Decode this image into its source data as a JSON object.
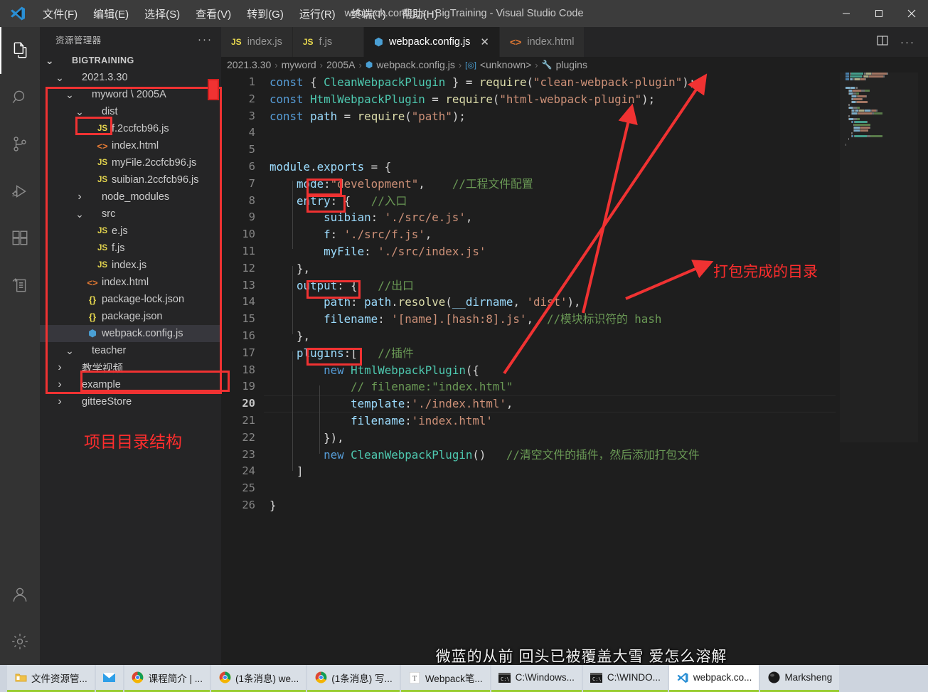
{
  "window": {
    "title": "webpack.config.js - BigTraining - Visual Studio Code",
    "minimize": "–",
    "maximize": "☐",
    "close": "✕"
  },
  "menu": [
    {
      "label": "文件(F)",
      "name": "menu-file"
    },
    {
      "label": "编辑(E)",
      "name": "menu-edit"
    },
    {
      "label": "选择(S)",
      "name": "menu-selection"
    },
    {
      "label": "查看(V)",
      "name": "menu-view"
    },
    {
      "label": "转到(G)",
      "name": "menu-go"
    },
    {
      "label": "运行(R)",
      "name": "menu-run"
    },
    {
      "label": "终端(T)",
      "name": "menu-terminal"
    },
    {
      "label": "帮助(H)",
      "name": "menu-help"
    }
  ],
  "activity_bar": {
    "items": [
      {
        "icon": "explorer-icon",
        "active": true
      },
      {
        "icon": "search-icon",
        "active": false
      },
      {
        "icon": "source-control-icon",
        "active": false
      },
      {
        "icon": "run-debug-icon",
        "active": false
      },
      {
        "icon": "extensions-icon",
        "active": false
      },
      {
        "icon": "remote-explorer-icon",
        "active": false
      }
    ],
    "bottom": [
      {
        "icon": "account-icon"
      },
      {
        "icon": "gear-icon"
      }
    ]
  },
  "sidebar": {
    "header": "资源管理器",
    "more": "···",
    "tree": [
      {
        "depth": 0,
        "chev": "v",
        "label": "BIGTRAINING",
        "icon": "",
        "root": true
      },
      {
        "depth": 1,
        "chev": "v",
        "label": "2021.3.30",
        "icon": ""
      },
      {
        "depth": 2,
        "chev": "v",
        "label": "myword \\ 2005A",
        "icon": ""
      },
      {
        "depth": 3,
        "chev": "v",
        "label": "dist",
        "icon": ""
      },
      {
        "depth": 4,
        "chev": "",
        "label": "f.2ccfcb96.js",
        "icon": "js"
      },
      {
        "depth": 4,
        "chev": "",
        "label": "index.html",
        "icon": "html"
      },
      {
        "depth": 4,
        "chev": "",
        "label": "myFile.2ccfcb96.js",
        "icon": "js"
      },
      {
        "depth": 4,
        "chev": "",
        "label": "suibian.2ccfcb96.js",
        "icon": "js"
      },
      {
        "depth": 3,
        "chev": ">",
        "label": "node_modules",
        "icon": ""
      },
      {
        "depth": 3,
        "chev": "v",
        "label": "src",
        "icon": ""
      },
      {
        "depth": 4,
        "chev": "",
        "label": "e.js",
        "icon": "js"
      },
      {
        "depth": 4,
        "chev": "",
        "label": "f.js",
        "icon": "js"
      },
      {
        "depth": 4,
        "chev": "",
        "label": "index.js",
        "icon": "js"
      },
      {
        "depth": 3,
        "chev": "",
        "label": "index.html",
        "icon": "html"
      },
      {
        "depth": 3,
        "chev": "",
        "label": "package-lock.json",
        "icon": "json"
      },
      {
        "depth": 3,
        "chev": "",
        "label": "package.json",
        "icon": "json"
      },
      {
        "depth": 3,
        "chev": "",
        "label": "webpack.config.js",
        "icon": "wp",
        "selected": true
      },
      {
        "depth": 2,
        "chev": "v",
        "label": "teacher",
        "icon": ""
      },
      {
        "depth": 1,
        "chev": ">",
        "label": "教学视频",
        "icon": ""
      },
      {
        "depth": 1,
        "chev": ">",
        "label": "example",
        "icon": ""
      },
      {
        "depth": 1,
        "chev": ">",
        "label": "gitteeStore",
        "icon": ""
      }
    ]
  },
  "tabs": [
    {
      "label": "index.js",
      "icon": "js-icon",
      "active": false,
      "dirty": false
    },
    {
      "label": "f.js",
      "icon": "js-icon",
      "active": false,
      "dirty": false
    },
    {
      "label": "webpack.config.js",
      "icon": "webpack-icon",
      "active": true,
      "close": "✕"
    },
    {
      "label": "index.html",
      "icon": "html-icon",
      "active": false,
      "dirty": false
    }
  ],
  "tab_actions": {
    "split_editor": "split-editor-icon",
    "more": "···"
  },
  "breadcrumb": [
    {
      "label": "2021.3.30",
      "icon": ""
    },
    {
      "label": "myword",
      "icon": ""
    },
    {
      "label": "2005A",
      "icon": ""
    },
    {
      "label": "webpack.config.js",
      "icon": "webpack-icon"
    },
    {
      "label": "<unknown>",
      "icon": "symbol-icon"
    },
    {
      "label": "plugins",
      "icon": "wrench-icon"
    }
  ],
  "editor": {
    "line_count": 26,
    "current_line": 20,
    "lines": [
      {
        "n": 1,
        "tokens": [
          {
            "t": "k",
            "v": "const"
          },
          {
            "t": "op",
            "v": " { "
          },
          {
            "t": "t",
            "v": "CleanWebpackPlugin"
          },
          {
            "t": "op",
            "v": " } = "
          },
          {
            "t": "f",
            "v": "require"
          },
          {
            "t": "op",
            "v": "("
          },
          {
            "t": "s",
            "v": "\"clean-webpack-plugin\""
          },
          {
            "t": "op",
            "v": ");"
          }
        ]
      },
      {
        "n": 2,
        "tokens": [
          {
            "t": "k",
            "v": "const"
          },
          {
            "t": "op",
            "v": " "
          },
          {
            "t": "t",
            "v": "HtmlWebpackPlugin"
          },
          {
            "t": "op",
            "v": " = "
          },
          {
            "t": "f",
            "v": "require"
          },
          {
            "t": "op",
            "v": "("
          },
          {
            "t": "s",
            "v": "\"html-webpack-plugin\""
          },
          {
            "t": "op",
            "v": ");"
          }
        ]
      },
      {
        "n": 3,
        "tokens": [
          {
            "t": "k",
            "v": "const"
          },
          {
            "t": "op",
            "v": " "
          },
          {
            "t": "p",
            "v": "path"
          },
          {
            "t": "op",
            "v": " = "
          },
          {
            "t": "f",
            "v": "require"
          },
          {
            "t": "op",
            "v": "("
          },
          {
            "t": "s",
            "v": "\"path\""
          },
          {
            "t": "op",
            "v": ");"
          }
        ]
      },
      {
        "n": 4,
        "tokens": []
      },
      {
        "n": 5,
        "tokens": []
      },
      {
        "n": 6,
        "tokens": [
          {
            "t": "p",
            "v": "module"
          },
          {
            "t": "op",
            "v": "."
          },
          {
            "t": "p",
            "v": "exports"
          },
          {
            "t": "op",
            "v": " = {"
          }
        ]
      },
      {
        "n": 7,
        "tokens": [
          {
            "t": "op",
            "v": "    "
          },
          {
            "t": "p",
            "v": "mode"
          },
          {
            "t": "op",
            "v": ":"
          },
          {
            "t": "s",
            "v": "\"development\""
          },
          {
            "t": "op",
            "v": ",    "
          },
          {
            "t": "c",
            "v": "//工程文件配置"
          }
        ]
      },
      {
        "n": 8,
        "tokens": [
          {
            "t": "op",
            "v": "    "
          },
          {
            "t": "p",
            "v": "entry"
          },
          {
            "t": "op",
            "v": ": {   "
          },
          {
            "t": "c",
            "v": "//入口"
          }
        ]
      },
      {
        "n": 9,
        "tokens": [
          {
            "t": "op",
            "v": "        "
          },
          {
            "t": "p",
            "v": "suibian"
          },
          {
            "t": "op",
            "v": ": "
          },
          {
            "t": "s",
            "v": "'./src/e.js'"
          },
          {
            "t": "op",
            "v": ","
          }
        ]
      },
      {
        "n": 10,
        "tokens": [
          {
            "t": "op",
            "v": "        "
          },
          {
            "t": "p",
            "v": "f"
          },
          {
            "t": "op",
            "v": ": "
          },
          {
            "t": "s",
            "v": "'./src/f.js'"
          },
          {
            "t": "op",
            "v": ","
          }
        ]
      },
      {
        "n": 11,
        "tokens": [
          {
            "t": "op",
            "v": "        "
          },
          {
            "t": "p",
            "v": "myFile"
          },
          {
            "t": "op",
            "v": ": "
          },
          {
            "t": "s",
            "v": "'./src/index.js'"
          }
        ]
      },
      {
        "n": 12,
        "tokens": [
          {
            "t": "op",
            "v": "    },"
          }
        ]
      },
      {
        "n": 13,
        "tokens": [
          {
            "t": "op",
            "v": "    "
          },
          {
            "t": "p",
            "v": "output"
          },
          {
            "t": "op",
            "v": ": {   "
          },
          {
            "t": "c",
            "v": "//出口"
          }
        ]
      },
      {
        "n": 14,
        "tokens": [
          {
            "t": "op",
            "v": "        "
          },
          {
            "t": "p",
            "v": "path"
          },
          {
            "t": "op",
            "v": ": "
          },
          {
            "t": "p",
            "v": "path"
          },
          {
            "t": "op",
            "v": "."
          },
          {
            "t": "f",
            "v": "resolve"
          },
          {
            "t": "op",
            "v": "("
          },
          {
            "t": "p",
            "v": "__dirname"
          },
          {
            "t": "op",
            "v": ", "
          },
          {
            "t": "s",
            "v": "'dist'"
          },
          {
            "t": "op",
            "v": "),"
          }
        ]
      },
      {
        "n": 15,
        "tokens": [
          {
            "t": "op",
            "v": "        "
          },
          {
            "t": "p",
            "v": "filename"
          },
          {
            "t": "op",
            "v": ": "
          },
          {
            "t": "s",
            "v": "'[name].[hash:8].js'"
          },
          {
            "t": "op",
            "v": ",  "
          },
          {
            "t": "c",
            "v": "//模块标识符的 hash"
          }
        ]
      },
      {
        "n": 16,
        "tokens": [
          {
            "t": "op",
            "v": "    },"
          }
        ]
      },
      {
        "n": 17,
        "tokens": [
          {
            "t": "op",
            "v": "    "
          },
          {
            "t": "p",
            "v": "plugins"
          },
          {
            "t": "op",
            "v": ":[   "
          },
          {
            "t": "c",
            "v": "//插件"
          }
        ]
      },
      {
        "n": 18,
        "tokens": [
          {
            "t": "op",
            "v": "        "
          },
          {
            "t": "k",
            "v": "new"
          },
          {
            "t": "op",
            "v": " "
          },
          {
            "t": "t",
            "v": "HtmlWebpackPlugin"
          },
          {
            "t": "op",
            "v": "({"
          }
        ]
      },
      {
        "n": 19,
        "tokens": [
          {
            "t": "op",
            "v": "            "
          },
          {
            "t": "c",
            "v": "// filename:\"index.html\""
          }
        ]
      },
      {
        "n": 20,
        "tokens": [
          {
            "t": "op",
            "v": "            "
          },
          {
            "t": "p",
            "v": "template"
          },
          {
            "t": "op",
            "v": ":"
          },
          {
            "t": "s",
            "v": "'./index.html'"
          },
          {
            "t": "op",
            "v": ","
          }
        ]
      },
      {
        "n": 21,
        "tokens": [
          {
            "t": "op",
            "v": "            "
          },
          {
            "t": "p",
            "v": "filename"
          },
          {
            "t": "op",
            "v": ":"
          },
          {
            "t": "s",
            "v": "'index.html'"
          }
        ]
      },
      {
        "n": 22,
        "tokens": [
          {
            "t": "op",
            "v": "        }),"
          }
        ]
      },
      {
        "n": 23,
        "tokens": [
          {
            "t": "op",
            "v": "        "
          },
          {
            "t": "k",
            "v": "new"
          },
          {
            "t": "op",
            "v": " "
          },
          {
            "t": "t",
            "v": "CleanWebpackPlugin"
          },
          {
            "t": "op",
            "v": "()   "
          },
          {
            "t": "c",
            "v": "//清空文件的插件，然后添加打包文件"
          }
        ]
      },
      {
        "n": 24,
        "tokens": [
          {
            "t": "op",
            "v": "    ]"
          }
        ]
      },
      {
        "n": 25,
        "tokens": []
      },
      {
        "n": 26,
        "tokens": [
          {
            "t": "op",
            "v": "}"
          }
        ]
      }
    ]
  },
  "annotations": {
    "color": "#ff2d2d",
    "label_output_dir": "打包完成的目录",
    "label_project_tree": "项目目录结构",
    "boxes": [
      {
        "name": "dist-highlight"
      },
      {
        "name": "webpack-config-highlight"
      },
      {
        "name": "project-tree-highlight"
      },
      {
        "name": "mode-key-highlight"
      },
      {
        "name": "entry-key-highlight"
      },
      {
        "name": "output-key-highlight"
      },
      {
        "name": "plugins-key-highlight"
      }
    ]
  },
  "subtitle": "微蓝的从前 回头已被覆盖大雪 爱怎么溶解",
  "taskbar": [
    {
      "label": "文件资源管...",
      "icon": "folder-icon",
      "active": false
    },
    {
      "label": "",
      "icon": "mail-icon",
      "active": false
    },
    {
      "label": "课程简介 | ...",
      "icon": "chrome-icon",
      "active": false
    },
    {
      "label": "(1条消息) we...",
      "icon": "chrome-icon",
      "active": false
    },
    {
      "label": "(1条消息) 写...",
      "icon": "chrome-icon",
      "active": false
    },
    {
      "label": "Webpack笔...",
      "icon": "typora-icon",
      "active": false
    },
    {
      "label": "C:\\Windows...",
      "icon": "cmd-icon",
      "active": false
    },
    {
      "label": "C:\\WINDO...",
      "icon": "cmd-icon",
      "active": false
    },
    {
      "label": "webpack.co...",
      "icon": "vscode-icon",
      "active": true
    },
    {
      "label": "Marksheng",
      "icon": "marksheng-icon",
      "active": false
    }
  ]
}
